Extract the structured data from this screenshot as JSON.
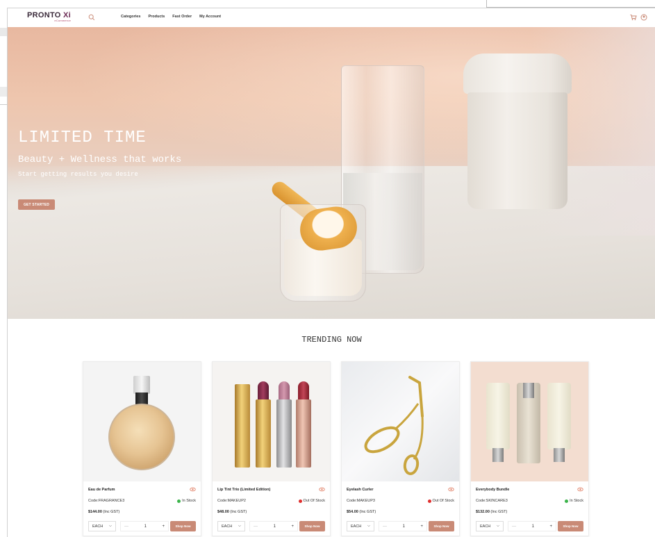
{
  "brand": {
    "name_main": "PRONTO ",
    "name_accent": "Xi",
    "tagline": "eCommerce"
  },
  "nav": {
    "items": [
      "Categories",
      "Products",
      "Fast Order",
      "My Account"
    ]
  },
  "icons": {
    "search": "search-icon",
    "cart": "cart-icon",
    "account": "user-icon",
    "view": "eye-icon"
  },
  "hero": {
    "title": "LIMITED TIME",
    "subtitle": "Beauty + Wellness that works",
    "text": "Start getting results you desire",
    "button": "GET STARTED"
  },
  "trending": {
    "heading": "TRENDING NOW"
  },
  "products": [
    {
      "name": "Eau de Parfum",
      "code": "Code:FRAGRANCE3",
      "stock": "In Stock",
      "stock_color": "#3cb44b",
      "price": "$144.00",
      "tax": "(Inc GST)",
      "uom": "EACH",
      "qty": "1",
      "button": "Shop Now"
    },
    {
      "name": "Lip Tint Trio (Limited Edition)",
      "code": "Code:MAKEUP2",
      "stock": "Out Of Stock",
      "stock_color": "#e0302f",
      "price": "$48.00",
      "tax": "(Inc GST)",
      "uom": "EACH",
      "qty": "1",
      "button": "Shop Now"
    },
    {
      "name": "Eyelash Curler",
      "code": "Code:MAKEUP3",
      "stock": "Out Of Stock",
      "stock_color": "#e0302f",
      "price": "$54.00",
      "tax": "(Inc GST)",
      "uom": "EACH",
      "qty": "1",
      "button": "Shop Now"
    },
    {
      "name": "Everybody Bundle",
      "code": "Code:SKINCARE3",
      "stock": "In Stock",
      "stock_color": "#3cb44b",
      "price": "$132.00",
      "tax": "(Inc GST)",
      "uom": "EACH",
      "qty": "1",
      "button": "Shop Now"
    }
  ],
  "colors": {
    "accent": "#c98a76",
    "brand": "#6b2b55"
  }
}
